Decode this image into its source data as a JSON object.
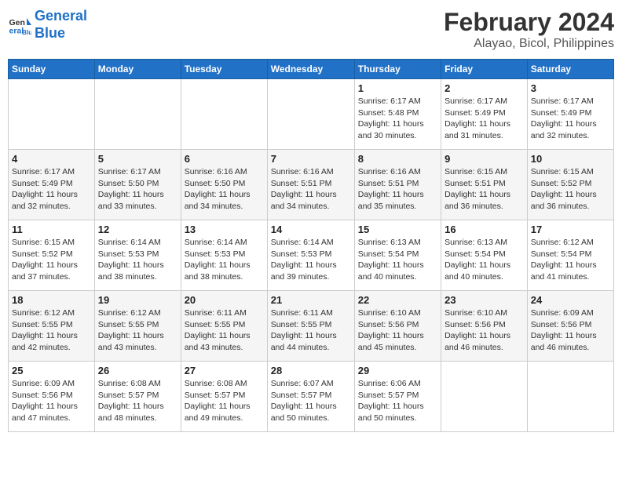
{
  "header": {
    "logo_line1": "General",
    "logo_line2": "Blue",
    "month": "February 2024",
    "location": "Alayao, Bicol, Philippines"
  },
  "weekdays": [
    "Sunday",
    "Monday",
    "Tuesday",
    "Wednesday",
    "Thursday",
    "Friday",
    "Saturday"
  ],
  "weeks": [
    [
      {
        "day": "",
        "info": ""
      },
      {
        "day": "",
        "info": ""
      },
      {
        "day": "",
        "info": ""
      },
      {
        "day": "",
        "info": ""
      },
      {
        "day": "1",
        "info": "Sunrise: 6:17 AM\nSunset: 5:48 PM\nDaylight: 11 hours\nand 30 minutes."
      },
      {
        "day": "2",
        "info": "Sunrise: 6:17 AM\nSunset: 5:49 PM\nDaylight: 11 hours\nand 31 minutes."
      },
      {
        "day": "3",
        "info": "Sunrise: 6:17 AM\nSunset: 5:49 PM\nDaylight: 11 hours\nand 32 minutes."
      }
    ],
    [
      {
        "day": "4",
        "info": "Sunrise: 6:17 AM\nSunset: 5:49 PM\nDaylight: 11 hours\nand 32 minutes."
      },
      {
        "day": "5",
        "info": "Sunrise: 6:17 AM\nSunset: 5:50 PM\nDaylight: 11 hours\nand 33 minutes."
      },
      {
        "day": "6",
        "info": "Sunrise: 6:16 AM\nSunset: 5:50 PM\nDaylight: 11 hours\nand 34 minutes."
      },
      {
        "day": "7",
        "info": "Sunrise: 6:16 AM\nSunset: 5:51 PM\nDaylight: 11 hours\nand 34 minutes."
      },
      {
        "day": "8",
        "info": "Sunrise: 6:16 AM\nSunset: 5:51 PM\nDaylight: 11 hours\nand 35 minutes."
      },
      {
        "day": "9",
        "info": "Sunrise: 6:15 AM\nSunset: 5:51 PM\nDaylight: 11 hours\nand 36 minutes."
      },
      {
        "day": "10",
        "info": "Sunrise: 6:15 AM\nSunset: 5:52 PM\nDaylight: 11 hours\nand 36 minutes."
      }
    ],
    [
      {
        "day": "11",
        "info": "Sunrise: 6:15 AM\nSunset: 5:52 PM\nDaylight: 11 hours\nand 37 minutes."
      },
      {
        "day": "12",
        "info": "Sunrise: 6:14 AM\nSunset: 5:53 PM\nDaylight: 11 hours\nand 38 minutes."
      },
      {
        "day": "13",
        "info": "Sunrise: 6:14 AM\nSunset: 5:53 PM\nDaylight: 11 hours\nand 38 minutes."
      },
      {
        "day": "14",
        "info": "Sunrise: 6:14 AM\nSunset: 5:53 PM\nDaylight: 11 hours\nand 39 minutes."
      },
      {
        "day": "15",
        "info": "Sunrise: 6:13 AM\nSunset: 5:54 PM\nDaylight: 11 hours\nand 40 minutes."
      },
      {
        "day": "16",
        "info": "Sunrise: 6:13 AM\nSunset: 5:54 PM\nDaylight: 11 hours\nand 40 minutes."
      },
      {
        "day": "17",
        "info": "Sunrise: 6:12 AM\nSunset: 5:54 PM\nDaylight: 11 hours\nand 41 minutes."
      }
    ],
    [
      {
        "day": "18",
        "info": "Sunrise: 6:12 AM\nSunset: 5:55 PM\nDaylight: 11 hours\nand 42 minutes."
      },
      {
        "day": "19",
        "info": "Sunrise: 6:12 AM\nSunset: 5:55 PM\nDaylight: 11 hours\nand 43 minutes."
      },
      {
        "day": "20",
        "info": "Sunrise: 6:11 AM\nSunset: 5:55 PM\nDaylight: 11 hours\nand 43 minutes."
      },
      {
        "day": "21",
        "info": "Sunrise: 6:11 AM\nSunset: 5:55 PM\nDaylight: 11 hours\nand 44 minutes."
      },
      {
        "day": "22",
        "info": "Sunrise: 6:10 AM\nSunset: 5:56 PM\nDaylight: 11 hours\nand 45 minutes."
      },
      {
        "day": "23",
        "info": "Sunrise: 6:10 AM\nSunset: 5:56 PM\nDaylight: 11 hours\nand 46 minutes."
      },
      {
        "day": "24",
        "info": "Sunrise: 6:09 AM\nSunset: 5:56 PM\nDaylight: 11 hours\nand 46 minutes."
      }
    ],
    [
      {
        "day": "25",
        "info": "Sunrise: 6:09 AM\nSunset: 5:56 PM\nDaylight: 11 hours\nand 47 minutes."
      },
      {
        "day": "26",
        "info": "Sunrise: 6:08 AM\nSunset: 5:57 PM\nDaylight: 11 hours\nand 48 minutes."
      },
      {
        "day": "27",
        "info": "Sunrise: 6:08 AM\nSunset: 5:57 PM\nDaylight: 11 hours\nand 49 minutes."
      },
      {
        "day": "28",
        "info": "Sunrise: 6:07 AM\nSunset: 5:57 PM\nDaylight: 11 hours\nand 50 minutes."
      },
      {
        "day": "29",
        "info": "Sunrise: 6:06 AM\nSunset: 5:57 PM\nDaylight: 11 hours\nand 50 minutes."
      },
      {
        "day": "",
        "info": ""
      },
      {
        "day": "",
        "info": ""
      }
    ]
  ]
}
